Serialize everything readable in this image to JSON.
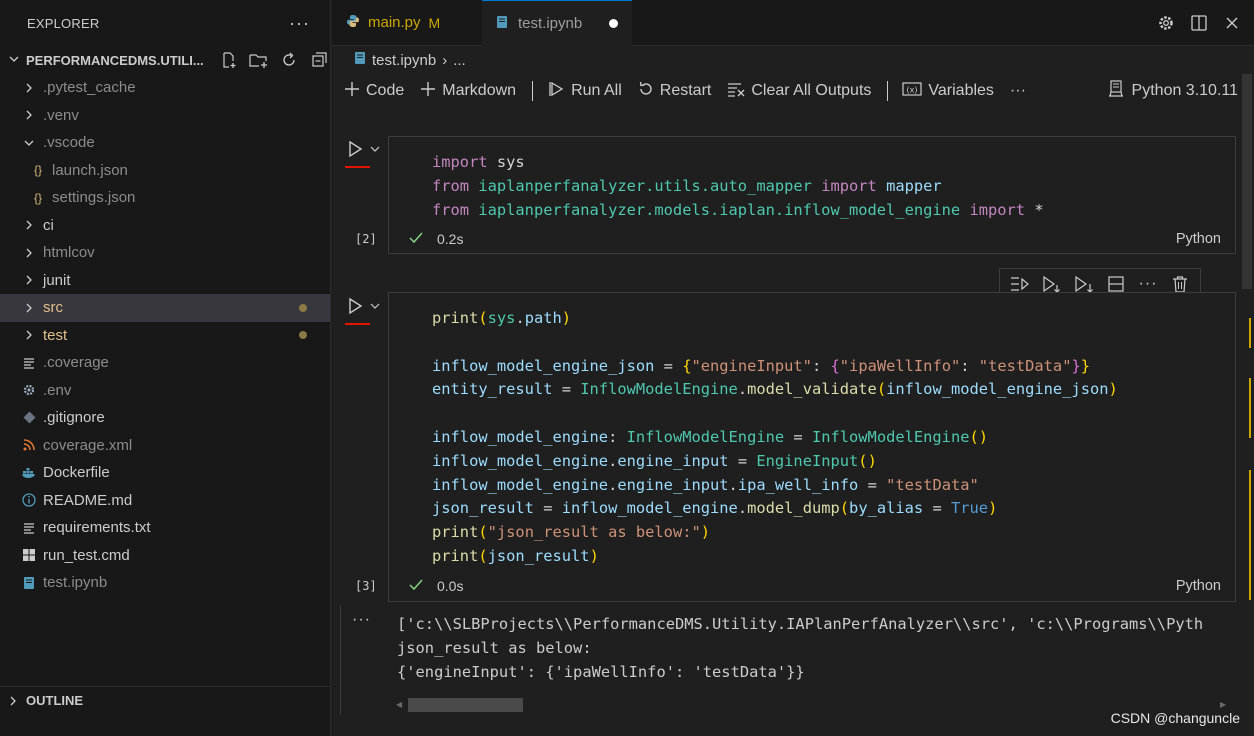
{
  "sidebar": {
    "title": "EXPLORER",
    "more": "···",
    "workspace": "PERFORMANCEDMS.UTILI...",
    "items": [
      {
        "label": ".pytest_cache",
        "kind": "folder",
        "expanded": false
      },
      {
        "label": ".venv",
        "kind": "folder",
        "expanded": false
      },
      {
        "label": ".vscode",
        "kind": "folder",
        "expanded": true
      },
      {
        "label": "launch.json",
        "kind": "json",
        "icon": "{}"
      },
      {
        "label": "settings.json",
        "kind": "json",
        "icon": "{}"
      },
      {
        "label": "ci",
        "kind": "folder",
        "expanded": false
      },
      {
        "label": "htmlcov",
        "kind": "folder",
        "expanded": false
      },
      {
        "label": "junit",
        "kind": "folder",
        "expanded": false
      },
      {
        "label": "src",
        "kind": "folder",
        "expanded": false
      },
      {
        "label": "test",
        "kind": "folder",
        "expanded": false
      },
      {
        "label": ".coverage",
        "kind": "file"
      },
      {
        "label": ".env",
        "kind": "file"
      },
      {
        "label": ".gitignore",
        "kind": "file"
      },
      {
        "label": "coverage.xml",
        "kind": "file"
      },
      {
        "label": "Dockerfile",
        "kind": "file"
      },
      {
        "label": "README.md",
        "kind": "file"
      },
      {
        "label": "requirements.txt",
        "kind": "file"
      },
      {
        "label": "run_test.cmd",
        "kind": "file"
      },
      {
        "label": "test.ipynb",
        "kind": "file"
      }
    ],
    "outline": "OUTLINE"
  },
  "tabs": [
    {
      "label": "main.py",
      "badge": "M"
    },
    {
      "label": "test.ipynb"
    }
  ],
  "breadcrumb": {
    "file": "test.ipynb",
    "sep": "›",
    "rest": "..."
  },
  "toolbar": {
    "code": "Code",
    "markdown": "Markdown",
    "run_all": "Run All",
    "restart": "Restart",
    "clear_outputs": "Clear All Outputs",
    "variables": "Variables",
    "more": "···",
    "kernel": "Python 3.10.11"
  },
  "cells": [
    {
      "exec_count": "[2]",
      "time": "0.2s",
      "language": "Python"
    },
    {
      "exec_count": "[3]",
      "time": "0.0s",
      "language": "Python"
    }
  ],
  "code1": {
    "l1a": "import",
    "l1b": " sys",
    "l2a": "from",
    "l2b": " iaplanperfanalyzer.utils.auto_mapper ",
    "l2c": "import",
    "l2d": " mapper",
    "l3a": "from",
    "l3b": " iaplanperfanalyzer.models.iaplan.inflow_model_engine ",
    "l3c": "import",
    "l3d": " *"
  },
  "code2": {
    "a1": "print",
    "a2": "(",
    "a3": "sys",
    "a4": ".",
    "a5": "path",
    "a6": ")",
    "b1": "inflow_model_engine_json",
    "b2": " = ",
    "b3": "{",
    "b4": "\"engineInput\"",
    "b5": ": ",
    "b6": "{",
    "b7": "\"ipaWellInfo\"",
    "b8": ": ",
    "b9": "\"testData\"",
    "b10": "}",
    "b11": "}",
    "c1": "entity_result",
    "c2": " = ",
    "c3": "InflowModelEngine",
    "c4": ".",
    "c5": "model_validate",
    "c6": "(",
    "c7": "inflow_model_engine_json",
    "c8": ")",
    "d1": "inflow_model_engine",
    "d2": ": ",
    "d3": "InflowModelEngine",
    "d4": " = ",
    "d5": "InflowModelEngine",
    "d6": "()",
    "e1": "inflow_model_engine",
    "e2": ".",
    "e3": "engine_input",
    "e4": " = ",
    "e5": "EngineInput",
    "e6": "()",
    "f1": "inflow_model_engine",
    "f2": ".",
    "f3": "engine_input",
    "f4": ".",
    "f5": "ipa_well_info",
    "f6": " = ",
    "f7": "\"testData\"",
    "g1": "json_result",
    "g2": " = ",
    "g3": "inflow_model_engine",
    "g4": ".",
    "g5": "model_dump",
    "g6": "(",
    "g7": "by_alias",
    "g8": " = ",
    "g9": "True",
    "g10": ")",
    "h1": "print",
    "h2": "(",
    "h3": "\"json_result as below:\"",
    "h4": ")",
    "i1": "print",
    "i2": "(",
    "i3": "json_result",
    "i4": ")"
  },
  "output": {
    "more": "···",
    "lines": [
      "['c:\\\\SLBProjects\\\\PerformanceDMS.Utility.IAPlanPerfAnalyzer\\\\src', 'c:\\\\Programs\\\\Pyth",
      "json_result as below:",
      "{'engineInput': {'ipaWellInfo': 'testData'}}"
    ]
  },
  "watermark": "CSDN @changuncle",
  "colors": {
    "modified": "#cca700",
    "accent": "#0078d4",
    "run_underline": "#e51400",
    "check": "#89d185"
  }
}
